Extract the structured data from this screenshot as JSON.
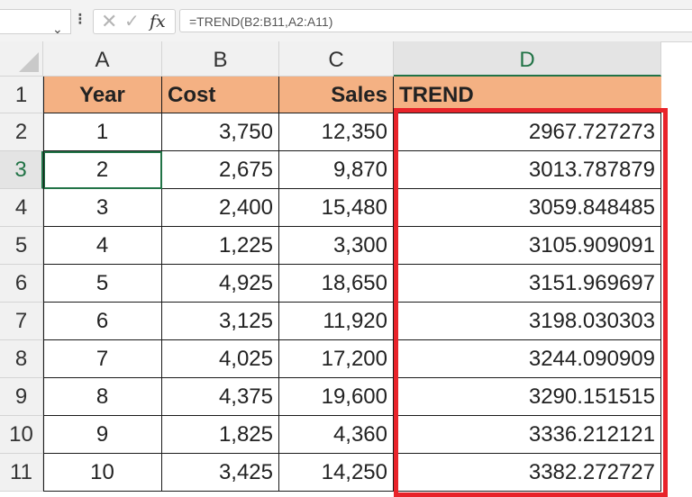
{
  "formula_bar": {
    "formula": "=TREND(B2:B11,A2:A11)",
    "fx_label": "fx",
    "cancel_symbol": "✕",
    "enter_symbol": "✓",
    "chevron_symbol": "⌄",
    "dots_symbol": "⁝"
  },
  "columns": [
    "A",
    "B",
    "C",
    "D"
  ],
  "selected_column": "D",
  "selected_row": "3",
  "row_numbers": [
    "1",
    "2",
    "3",
    "4",
    "5",
    "6",
    "7",
    "8",
    "9",
    "10",
    "11"
  ],
  "headers": {
    "year": "Year",
    "cost": "Cost",
    "sales": "Sales",
    "trend": "TREND"
  },
  "rows": [
    {
      "year": "1",
      "cost": "3,750",
      "sales": "12,350",
      "trend": "2967.727273"
    },
    {
      "year": "2",
      "cost": "2,675",
      "sales": "9,870",
      "trend": "3013.787879"
    },
    {
      "year": "3",
      "cost": "2,400",
      "sales": "15,480",
      "trend": "3059.848485"
    },
    {
      "year": "4",
      "cost": "1,225",
      "sales": "3,300",
      "trend": "3105.909091"
    },
    {
      "year": "5",
      "cost": "4,925",
      "sales": "18,650",
      "trend": "3151.969697"
    },
    {
      "year": "6",
      "cost": "3,125",
      "sales": "11,920",
      "trend": "3198.030303"
    },
    {
      "year": "7",
      "cost": "4,025",
      "sales": "17,200",
      "trend": "3244.090909"
    },
    {
      "year": "8",
      "cost": "4,375",
      "sales": "19,600",
      "trend": "3290.151515"
    },
    {
      "year": "9",
      "cost": "1,825",
      "sales": "4,360",
      "trend": "3336.212121"
    },
    {
      "year": "10",
      "cost": "3,425",
      "sales": "14,250",
      "trend": "3382.272727"
    }
  ],
  "colors": {
    "header_fill": "#f4b183",
    "highlight_border": "#e8232a",
    "selection": "#217346"
  }
}
